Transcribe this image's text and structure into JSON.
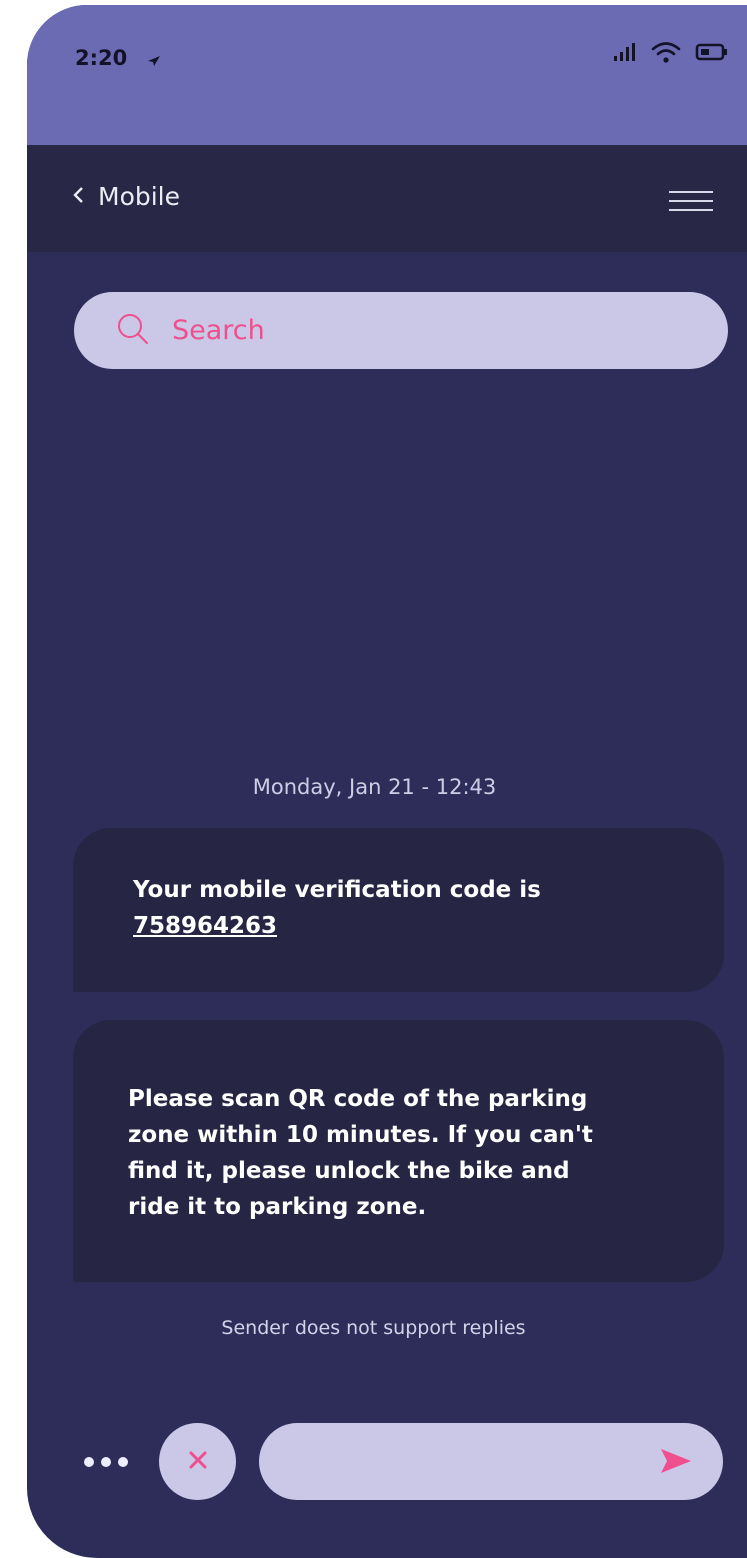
{
  "status_bar": {
    "time": "2:20",
    "icons": [
      "location-arrow-icon",
      "signal-icon",
      "wifi-icon",
      "battery-icon"
    ]
  },
  "nav": {
    "title": "Mobile",
    "back_icon": "chevron-left-icon",
    "menu_icon": "hamburger-menu-icon"
  },
  "search": {
    "placeholder": "Search",
    "icon": "search-icon"
  },
  "conversation": {
    "date_label": "Monday, Jan 21 - 12:43",
    "messages": [
      {
        "text": "Your mobile verification code is",
        "code": "758964263"
      },
      {
        "text": "Please scan QR code of the parking zone within 10 minutes. If  you can't find it, please unlock the bike and ride it to parking zone."
      }
    ],
    "footer_note": "Sender does not support replies"
  },
  "composer": {
    "more_icon": "more-dots-icon",
    "close_icon": "close-icon",
    "send_icon": "send-icon"
  },
  "colors": {
    "accent": "#ef4f8e",
    "header": "#6b6bb4",
    "navbar": "#282745",
    "background": "#2e2d5a",
    "bubble": "#262543",
    "pill": "#cac8e6"
  }
}
